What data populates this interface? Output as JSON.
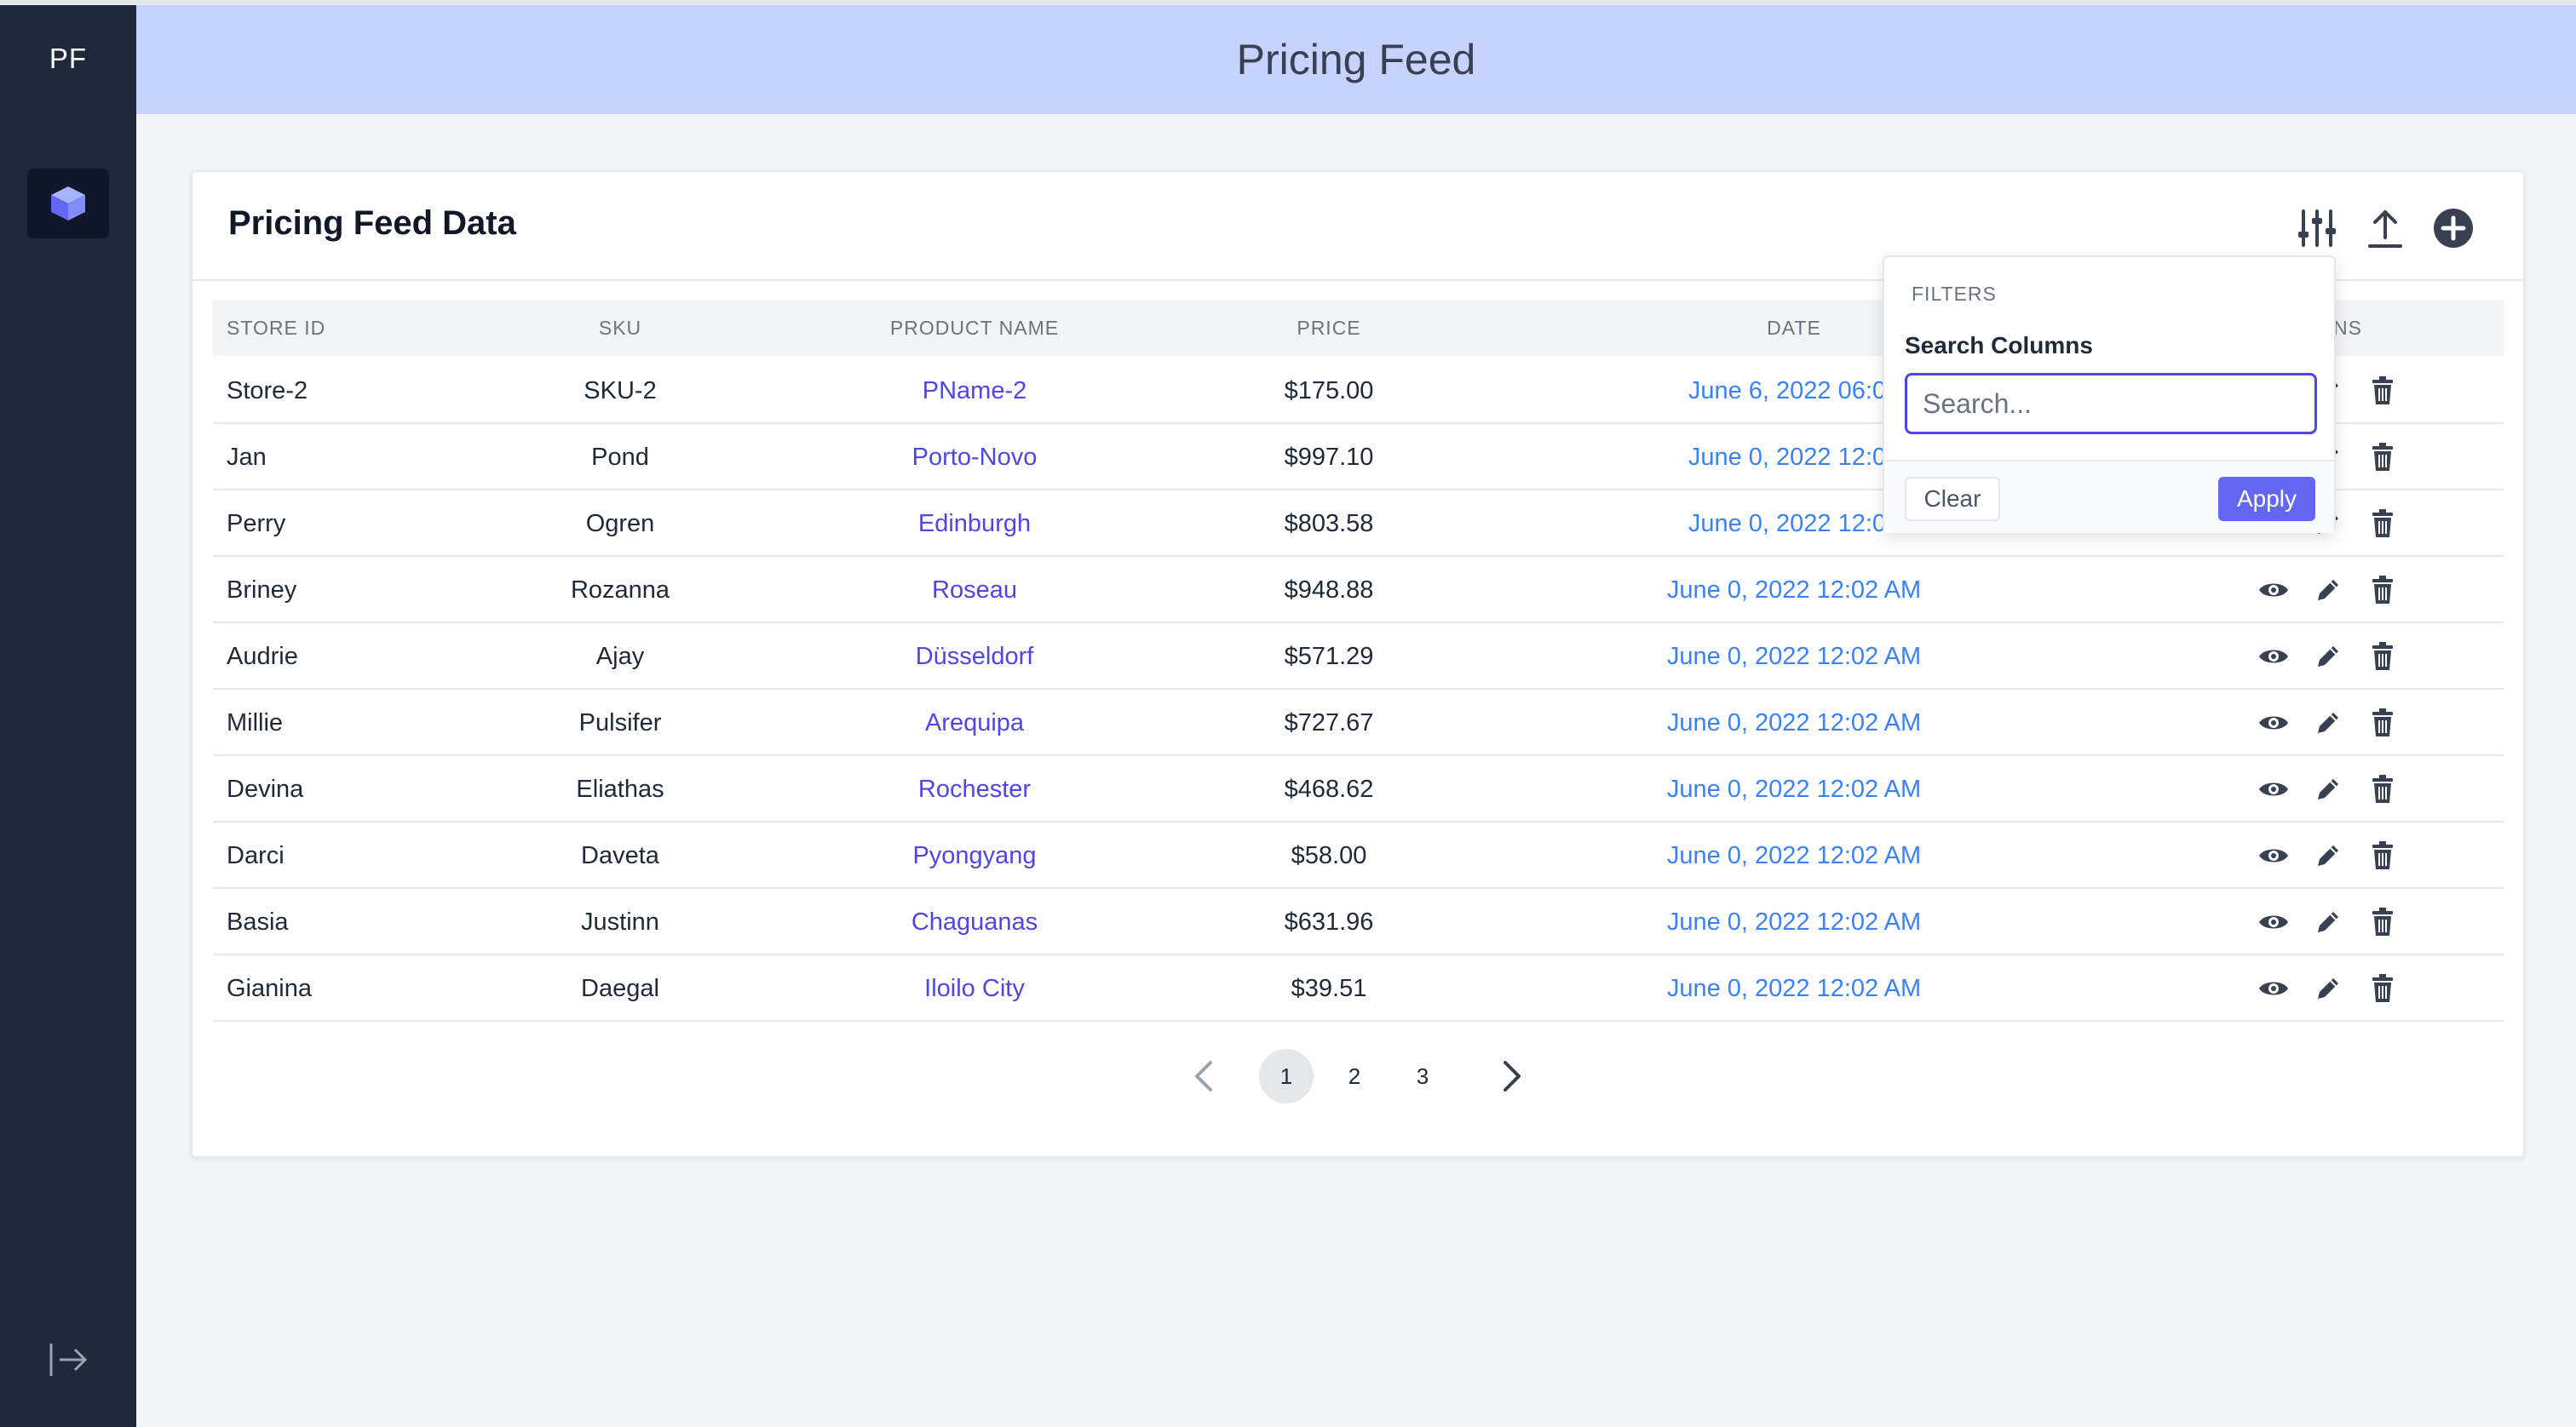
{
  "sidebar": {
    "brand": "PF",
    "nav_icon": "cube-icon",
    "footer_icon": "logout-arrow-icon"
  },
  "header": {
    "title": "Pricing Feed"
  },
  "card": {
    "title": "Pricing Feed Data",
    "toolbar_icons": [
      "sliders-icon",
      "upload-icon",
      "add-circle-icon"
    ]
  },
  "table": {
    "columns": [
      "STORE ID",
      "SKU",
      "PRODUCT NAME",
      "PRICE",
      "DATE",
      "NS"
    ],
    "rows": [
      {
        "store": "Store-2",
        "sku": "SKU-2",
        "product": "PName-2",
        "price": "$175.00",
        "date": "June 6, 2022 06:04"
      },
      {
        "store": "Jan",
        "sku": "Pond",
        "product": "Porto-Novo",
        "price": "$997.10",
        "date": "June 0, 2022 12:02"
      },
      {
        "store": "Perry",
        "sku": "Ogren",
        "product": "Edinburgh",
        "price": "$803.58",
        "date": "June 0, 2022 12:02"
      },
      {
        "store": "Briney",
        "sku": "Rozanna",
        "product": "Roseau",
        "price": "$948.88",
        "date": "June 0, 2022 12:02 AM"
      },
      {
        "store": "Audrie",
        "sku": "Ajay",
        "product": "Düsseldorf",
        "price": "$571.29",
        "date": "June 0, 2022 12:02 AM"
      },
      {
        "store": "Millie",
        "sku": "Pulsifer",
        "product": "Arequipa",
        "price": "$727.67",
        "date": "June 0, 2022 12:02 AM"
      },
      {
        "store": "Devina",
        "sku": "Eliathas",
        "product": "Rochester",
        "price": "$468.62",
        "date": "June 0, 2022 12:02 AM"
      },
      {
        "store": "Darci",
        "sku": "Daveta",
        "product": "Pyongyang",
        "price": "$58.00",
        "date": "June 0, 2022 12:02 AM"
      },
      {
        "store": "Basia",
        "sku": "Justinn",
        "product": "Chaguanas",
        "price": "$631.96",
        "date": "June 0, 2022 12:02 AM"
      },
      {
        "store": "Gianina",
        "sku": "Daegal",
        "product": "Iloilo City",
        "price": "$39.51",
        "date": "June 0, 2022 12:02 AM"
      }
    ],
    "row_actions": [
      "eye-icon",
      "pencil-icon",
      "trash-icon"
    ]
  },
  "pagination": {
    "pages": [
      "1",
      "2",
      "3"
    ],
    "current": "1"
  },
  "filters": {
    "heading": "FILTERS",
    "label": "Search Columns",
    "placeholder": "Search...",
    "clear_label": "Clear",
    "apply_label": "Apply"
  },
  "colors": {
    "sidebar": "#1e293b",
    "header": "#c7d2fe",
    "accent": "#6366f1",
    "link": "#4f46e5",
    "date": "#3b82f6"
  }
}
